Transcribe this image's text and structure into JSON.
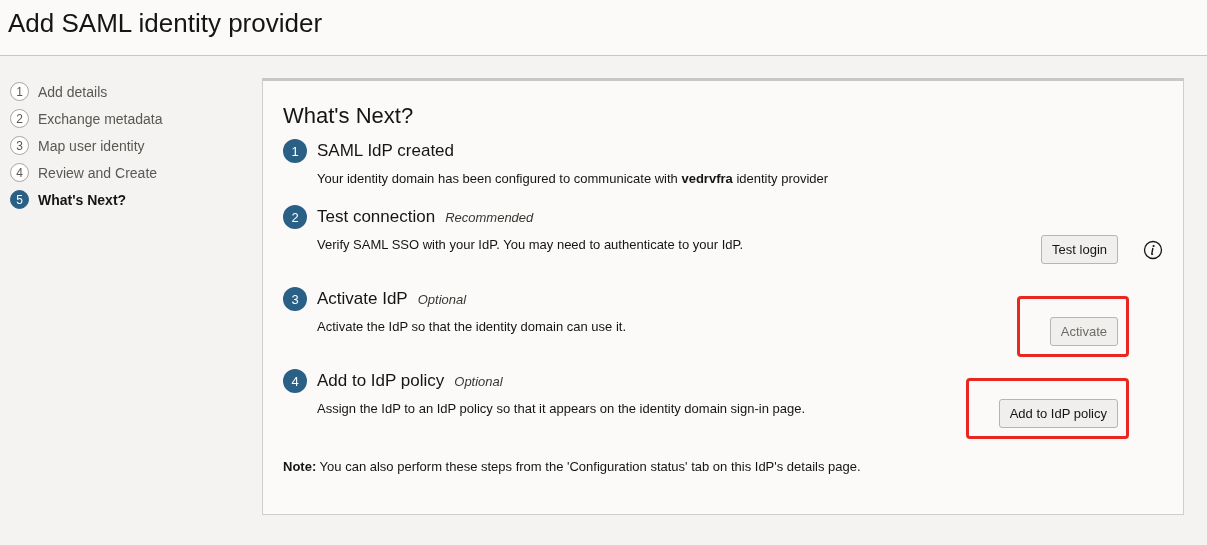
{
  "page_title": "Add SAML identity provider",
  "wizard_steps": [
    {
      "number": "1",
      "label": "Add details",
      "selected": false
    },
    {
      "number": "2",
      "label": "Exchange metadata",
      "selected": false
    },
    {
      "number": "3",
      "label": "Map user identity",
      "selected": false
    },
    {
      "number": "4",
      "label": "Review and Create",
      "selected": false
    },
    {
      "number": "5",
      "label": "What's Next?",
      "selected": true
    }
  ],
  "panel": {
    "heading": "What's Next?",
    "steps": [
      {
        "number": "1",
        "title": "SAML IdP created",
        "description": "Your identity domain has been configured to communicate with **vedrvfra** identity provider"
      },
      {
        "number": "2",
        "title": "Test connection",
        "tag": "Recommended",
        "description": "Verify SAML SSO with your IdP. You may need to authenticate to your IdP.",
        "button": {
          "label": "Test login",
          "disabled": false,
          "highlighted": false
        },
        "info": true
      },
      {
        "number": "3",
        "title": "Activate IdP",
        "tag": "Optional",
        "description": "Activate the IdP so that the identity domain can use it.",
        "button": {
          "label": "Activate",
          "disabled": true,
          "highlighted": true
        }
      },
      {
        "number": "4",
        "title": "Add to IdP policy",
        "tag": "Optional",
        "description": "Assign the IdP to an IdP policy so that it appears on the identity domain sign-in page.",
        "button": {
          "label": "Add to IdP policy",
          "disabled": false,
          "highlighted": true
        }
      }
    ],
    "note": "**Note:** You can also perform these steps from the 'Configuration status' tab on this IdP's details page."
  }
}
